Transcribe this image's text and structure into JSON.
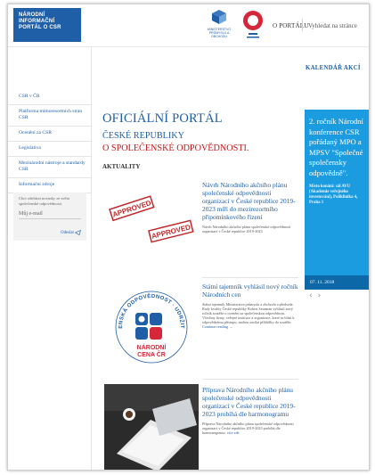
{
  "header": {
    "logo_lines": [
      "NÁRODNÍ",
      "INFORMAČNÍ",
      "PORTÁL O CSR"
    ],
    "mpo_caption": "MINISTERSTVO PRŮMYSLU A OBCHODU",
    "nav_portal": "O PORTÁLU",
    "nav_search": "Vyhledat na stránce"
  },
  "sidebar": {
    "items": [
      {
        "label": "CSR v ČR"
      },
      {
        "label": "Platforma mimoresortních stran CSR"
      },
      {
        "label": "Ocenění za CSR"
      },
      {
        "label": "Legislativa"
      },
      {
        "label": "Mezinárodní nástroje a standardy CSR"
      },
      {
        "label": "Informační zdroje"
      }
    ],
    "newsletter": {
      "text": "Chci odebírat novinky ze světa společenské odpovědnosti",
      "email_placeholder": "Můj e-mail",
      "send_label": "Odeslat"
    }
  },
  "main": {
    "title_line1": "OFICIÁLNÍ PORTÁL",
    "title_line2": "ČESKÉ REPUBLIKY",
    "title_line3": "O SPOLEČENSKÉ ODPOVĚDNOSTI.",
    "section_label": "AKTUALITY",
    "news": [
      {
        "title": "Návrh Národního akčního plánu společenské odpovědnosti organizací v České republice 2019-2023 míří do mezirezortního připomínkového řízení",
        "excerpt": "Návrh Národního akčního plánu společenské odpovědnosti organizací v České republice 2019-2023",
        "stamp1": "APPROVED",
        "stamp2": "APPROVED"
      },
      {
        "title": "Státní tajemník vyhlásil nový ročník Národních cen",
        "excerpt": "Státní tajemník Ministerstva průmyslu a obchodu a předseda Rady kvality České republiky Robert Szurman vyhlásil nový ročník soutěže o ocenění za společenskou odpovědnost. Všechny firmy, veřejné instituce a organizace, které se hlásí k odpovědnému přístupu, mohou zasílat přihlášky do soutěže.",
        "more": "Continue reading →",
        "ring_text": "SPOLEČENSKÁ ODPOVĚDNOST · UDRŽITELNOST",
        "cena_line1": "NÁRODNÍ",
        "cena_line2": "CENA ČR"
      },
      {
        "title": "Příprava Národního akčního plánu společenské odpovědnosti organizací v České republice 2019-2023 probíhá dle harmonogramu",
        "excerpt": "Příprava Národního akčního plánu společenské odpovědnosti organizací v České republice 2019-2023 probíhá dle harmonogramu.",
        "more": "více zde"
      }
    ]
  },
  "calendar": {
    "title": "KALENDÁŘ AKCÍ",
    "event": "2. ročník Národní konference CSR pořádaný MPO a MPSV \"Společné společensky odpovědně\".",
    "place": "Místo konání: sál AVU (Akademie veřejného investování), Poliklinika 4, Praha 1",
    "date": "07. 11. 2018",
    "prev": "‹",
    "next": "›"
  },
  "colors": {
    "brand_blue": "#1f5fa8",
    "accent_red": "#c41a1a",
    "calendar_blue": "#1b9ce0",
    "date_blue": "#0d68a8"
  }
}
